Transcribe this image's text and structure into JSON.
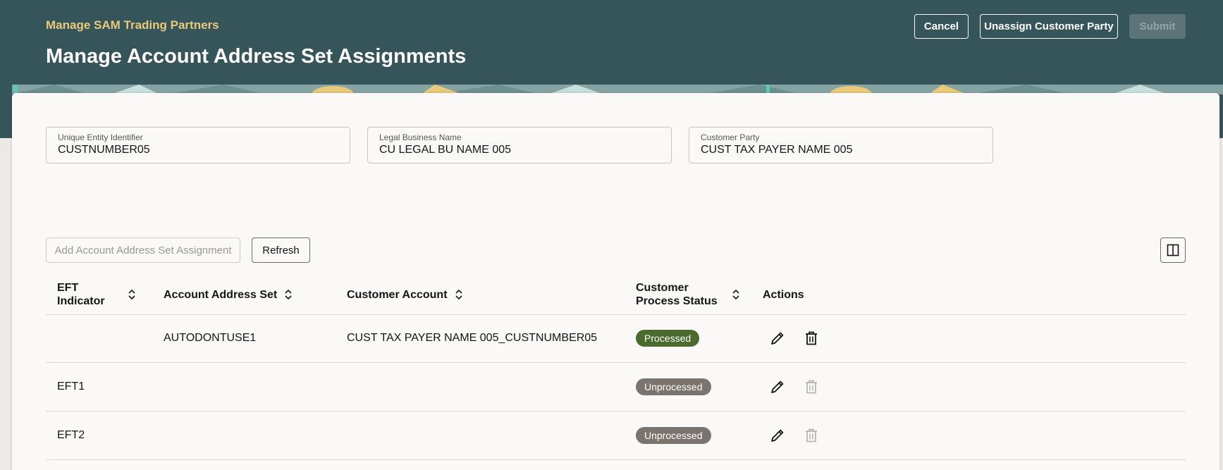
{
  "header": {
    "breadcrumb": "Manage SAM Trading Partners",
    "title": "Manage Account Address Set Assignments",
    "cancel_label": "Cancel",
    "unassign_label": "Unassign Customer Party",
    "submit_label": "Submit"
  },
  "fields": [
    {
      "label": "Unique Entity Identifier",
      "value": "CUSTNUMBER05"
    },
    {
      "label": "Legal Business Name",
      "value": "CU LEGAL BU NAME 005"
    },
    {
      "label": "Customer Party",
      "value": "CUST TAX PAYER NAME 005"
    }
  ],
  "toolbar": {
    "add_label": "Add Account Address Set Assignment",
    "refresh_label": "Refresh",
    "columns_icon": "columns-icon"
  },
  "table": {
    "headers": {
      "eft": "EFT Indicator",
      "set": "Account Address Set",
      "account": "Customer Account",
      "status": "Customer Process Status",
      "actions": "Actions"
    },
    "rows": [
      {
        "eft": "",
        "set": "AUTODONTUSE1",
        "account": "CUST TAX PAYER NAME 005_CUSTNUMBER05",
        "status": "Processed"
      },
      {
        "eft": "EFT1",
        "set": "",
        "account": "",
        "status": "Unprocessed"
      },
      {
        "eft": "EFT2",
        "set": "",
        "account": "",
        "status": "Unprocessed"
      }
    ]
  },
  "colors": {
    "header_bg": "#36555a",
    "breadcrumb": "#e9c97a",
    "processed": "#4b6b2e",
    "unprocessed": "#7a736e"
  }
}
